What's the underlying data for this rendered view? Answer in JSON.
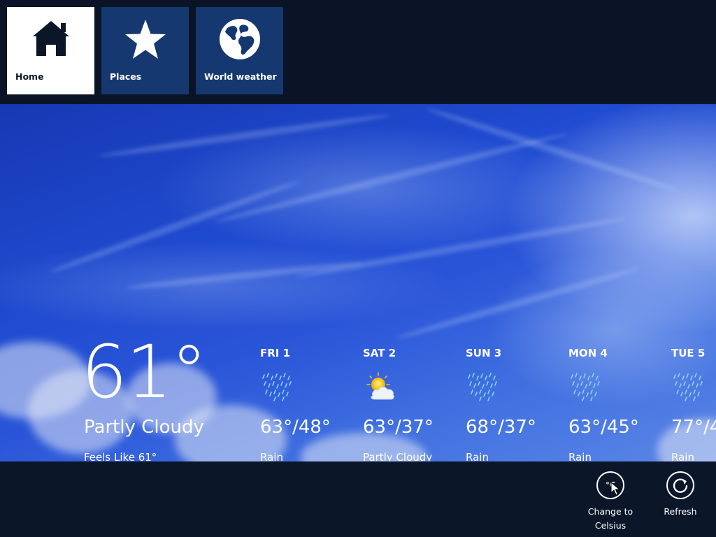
{
  "nav": {
    "tiles": [
      {
        "label": "Home",
        "icon": "home-icon",
        "active": true
      },
      {
        "label": "Places",
        "icon": "star-icon",
        "active": false
      },
      {
        "label": "World weather",
        "icon": "globe-icon",
        "active": false
      }
    ]
  },
  "current": {
    "temperature": "61°",
    "condition": "Partly Cloudy",
    "feels_like": "Feels Like 61°"
  },
  "forecast": [
    {
      "day": "FRI 1",
      "temps": "63°/48°",
      "condition": "Rain",
      "icon": "rain-icon"
    },
    {
      "day": "SAT 2",
      "temps": "63°/37°",
      "condition": "Partly Cloudy",
      "icon": "partly-cloudy-icon"
    },
    {
      "day": "SUN 3",
      "temps": "68°/37°",
      "condition": "Rain",
      "icon": "rain-icon"
    },
    {
      "day": "MON 4",
      "temps": "63°/45°",
      "condition": "Rain",
      "icon": "rain-icon"
    },
    {
      "day": "TUE 5",
      "temps": "77°/4",
      "condition": "Rain",
      "icon": "rain-icon"
    }
  ],
  "appbar": {
    "change_units_label": "Change to Celsius",
    "change_units_line1": "Change to",
    "change_units_line2": "Celsius",
    "change_units_glyph": "°C",
    "refresh_label": "Refresh"
  },
  "colors": {
    "tile_background": "#14386f",
    "tile_active_background": "#ffffff",
    "chrome_background": "#0b1628"
  }
}
